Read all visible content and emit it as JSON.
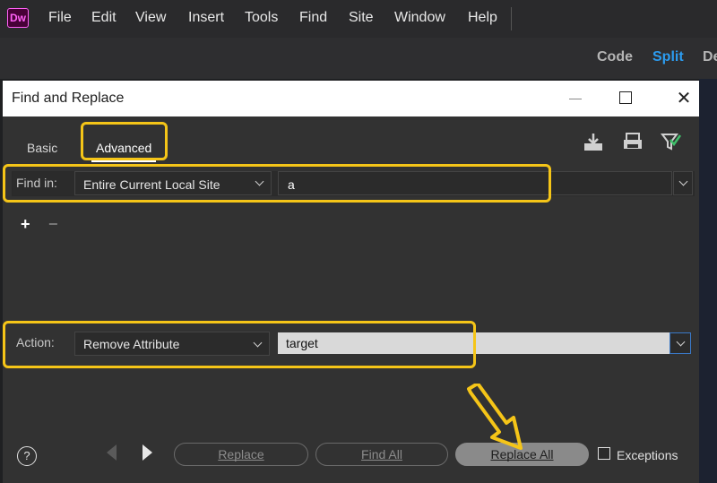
{
  "app": {
    "logo": "Dw"
  },
  "menubar": {
    "items": [
      "File",
      "Edit",
      "View",
      "Insert",
      "Tools",
      "Find",
      "Site",
      "Window",
      "Help"
    ]
  },
  "view_switcher": {
    "code": "Code",
    "split": "Split",
    "design": "De"
  },
  "dialog": {
    "title": "Find and Replace",
    "tabs": {
      "basic": "Basic",
      "advanced": "Advanced"
    },
    "find_row": {
      "label": "Find in:",
      "scope": "Entire Current Local Site",
      "tag_value": "a"
    },
    "action_row": {
      "label": "Action:",
      "action": "Remove Attribute",
      "attribute_value": "target"
    },
    "buttons": {
      "replace": "Replace",
      "find_all": "Find All",
      "replace_all": "Replace All"
    },
    "exceptions_label": "Exceptions",
    "help_glyph": "?"
  },
  "icons": [
    "dw-logo-icon",
    "save-query-icon",
    "load-query-icon",
    "clear-filter-icon",
    "help-icon",
    "prev-arrow-icon",
    "next-arrow-icon",
    "chevron-down-icon"
  ],
  "colors": {
    "highlight": "#f5c518",
    "split_active": "#2c9cf0",
    "dialog_bg": "#323232"
  }
}
